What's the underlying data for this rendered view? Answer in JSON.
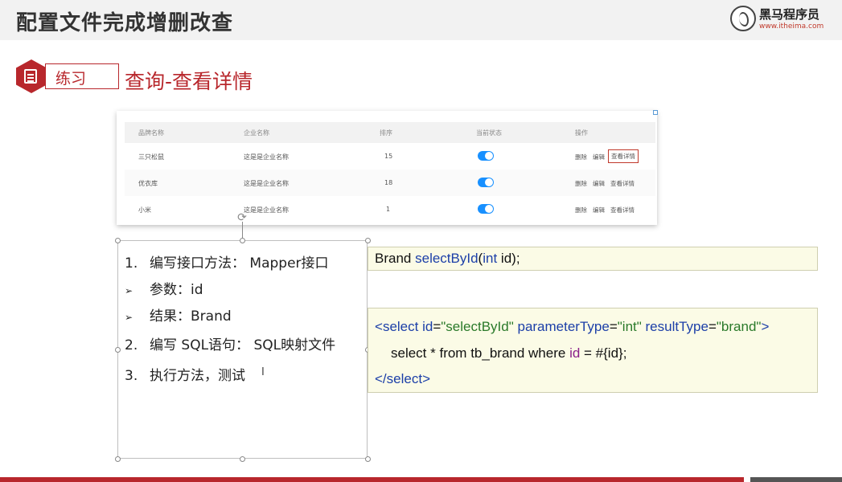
{
  "header": {
    "title": "配置文件完成增删改查",
    "logo_name": "黑马程序员",
    "logo_url": "www.itheima.com"
  },
  "badge": {
    "label": "练习"
  },
  "section_title": "查询-查看详情",
  "table": {
    "columns": [
      "品牌名称",
      "企业名称",
      "排序",
      "当前状态",
      "操作"
    ],
    "rows": [
      {
        "brand": "三只松鼠",
        "company": "这是是企业名称",
        "order": "15",
        "status_on": true
      },
      {
        "brand": "优衣库",
        "company": "这是是企业名称",
        "order": "18",
        "status_on": true
      },
      {
        "brand": "小米",
        "company": "这是是企业名称",
        "order": "1",
        "status_on": true
      }
    ],
    "ops": {
      "delete": "删除",
      "edit": "编辑",
      "detail": "查看详情"
    }
  },
  "steps": {
    "s1_num": "1.",
    "s1_text": "编写接口方法： Mapper接口",
    "b1": "参数：id",
    "b2": "结果：Brand",
    "s2_num": "2.",
    "s2_text": "编写 SQL语句： SQL映射文件",
    "s3_num": "3.",
    "s3_text": "执行方法，测试",
    "bullet_glyph": "➢"
  },
  "code_method": {
    "type": "Brand",
    "name": "selectById",
    "open": "(",
    "param_type": "int",
    "param_name": " id",
    "close": ");"
  },
  "code_xml": {
    "l1_open": "<",
    "l1_tag": "select",
    "l1_attr1": " id",
    "l1_eq1": "=",
    "l1_val1": "\"selectById\"",
    "l1_attr2": " parameterType",
    "l1_eq2": "=",
    "l1_val2": "\"int\"",
    "l1_attr3": " resultType",
    "l1_eq3": "=",
    "l1_val3": "\"brand\"",
    "l1_close": ">",
    "l2_pre": "select * from tb_brand where ",
    "l2_id": "id",
    "l2_post": " = #{id};",
    "l3_open": "</",
    "l3_tag": "select",
    "l3_close": ">"
  },
  "colors": {
    "accent_red": "#b8272c",
    "toggle_blue": "#1890ff",
    "code_bg": "#fbfbe6"
  }
}
